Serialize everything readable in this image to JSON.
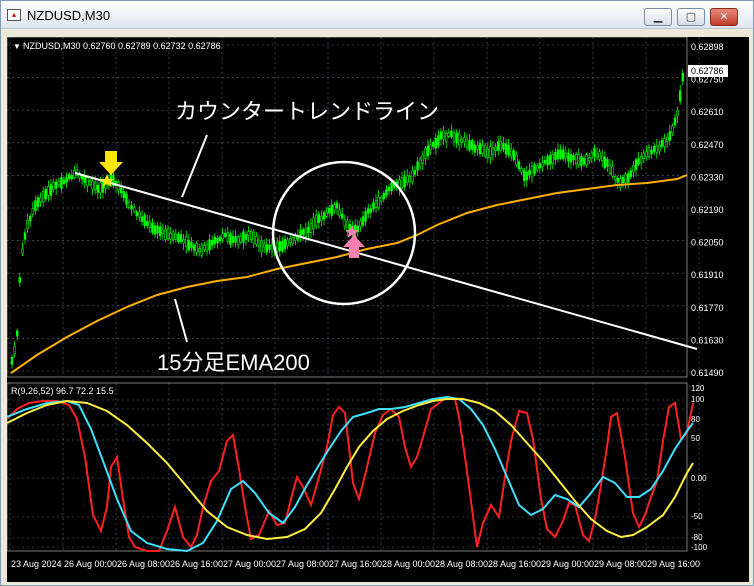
{
  "window": {
    "title": "NZDUSD,M30",
    "app_icon": "chart-icon",
    "buttons": {
      "minimize": "▁",
      "maximize": "▢",
      "close": "✕"
    }
  },
  "main_chart": {
    "header": "NZDUSD,M30  0.62760 0.62789 0.62732 0.62786",
    "current_price": "0.62786",
    "price_ticks": [
      "0.62898",
      "0.62750",
      "0.62610",
      "0.62470",
      "0.62330",
      "0.62190",
      "0.62050",
      "0.61910",
      "0.61770",
      "0.61630",
      "0.61490"
    ],
    "annotation_trendline": "カウンタートレンドライン",
    "annotation_ema": "15分足EMA200"
  },
  "sub_chart": {
    "header": "R(9,26,52) 96.7 72.2 15.5",
    "ticks": [
      "120",
      "100",
      "80",
      "50",
      "0.00",
      "-50",
      "-80",
      "-100"
    ]
  },
  "time_axis": [
    "23 Aug 2024",
    "26 Aug 00:00",
    "26 Aug 08:00",
    "26 Aug 16:00",
    "27 Aug 00:00",
    "27 Aug 08:00",
    "27 Aug 16:00",
    "28 Aug 00:00",
    "28 Aug 08:00",
    "28 Aug 16:00",
    "29 Aug 00:00",
    "29 Aug 08:00",
    "29 Aug 16:00",
    "29 Aug 00:00"
  ],
  "colors": {
    "background": "#000000",
    "candle": "#00ff00",
    "ema": "#ffb000",
    "trendline": "#ffffff",
    "rsi_fast": "#ff2020",
    "rsi_mid": "#3ee0ff",
    "rsi_slow": "#ffef40",
    "grid": "#5a6e82"
  }
}
